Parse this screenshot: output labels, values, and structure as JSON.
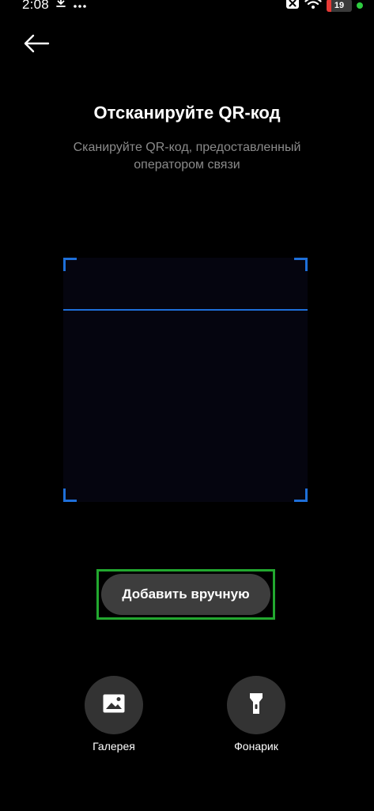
{
  "status_bar": {
    "time": "2:08",
    "left_icons": [
      "download-icon",
      "more-icon"
    ],
    "right_icons": [
      "notification-muted-icon",
      "wifi-icon"
    ],
    "battery_level": "19",
    "battery_color": "#e53935",
    "charging_indicator_color": "#2ecc40"
  },
  "header": {
    "back_icon": "arrow-left-icon"
  },
  "main": {
    "title": "Отсканируйте QR-код",
    "subtitle": "Сканируйте QR-код, предоставленный оператором связи",
    "scan_frame_accent": "#1e6fd9"
  },
  "actions": {
    "add_manually_label": "Добавить вручную",
    "highlight_color": "#22a82f",
    "gallery": {
      "icon": "image-icon",
      "label": "Галерея"
    },
    "flashlight": {
      "icon": "flashlight-icon",
      "label": "Фонарик"
    }
  }
}
